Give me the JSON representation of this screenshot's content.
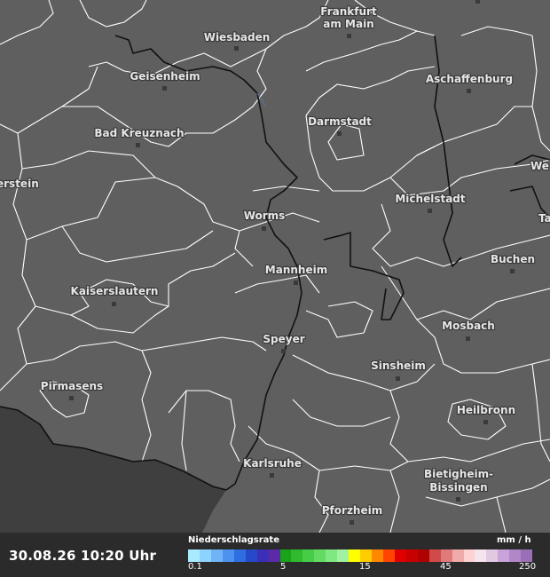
{
  "map": {
    "cities": [
      {
        "name": "Frankfurt\nam Main",
        "line1": "Frankfurt",
        "line2": "am Main"
      },
      {
        "name": "Wiesbaden"
      },
      {
        "name": "Geisenheim"
      },
      {
        "name": "Aschaffenburg"
      },
      {
        "name": "Bad Kreuznach"
      },
      {
        "name": "Darmstadt"
      },
      {
        "name": "Michelstadt"
      },
      {
        "name": "Worms"
      },
      {
        "name": "Buchen"
      },
      {
        "name": "Mannheim"
      },
      {
        "name": "Kaiserslautern"
      },
      {
        "name": "Speyer"
      },
      {
        "name": "Mosbach"
      },
      {
        "name": "Sinsheim"
      },
      {
        "name": "Pirmasens"
      },
      {
        "name": "Heilbronn"
      },
      {
        "name": "Karlsruhe"
      },
      {
        "name": "Bietigheim-\nBissingen",
        "line1": "Bietigheim-",
        "line2": "Bissingen"
      },
      {
        "name": "Pforzheim"
      },
      {
        "name": "erstein"
      },
      {
        "name": "We"
      },
      {
        "name": "Ta"
      }
    ],
    "colors": {
      "land": "#5f5f5f",
      "foreign": "#3f3f3f",
      "admin_border": "#ffffff",
      "state_border": "#111111"
    }
  },
  "footer": {
    "timestamp": "30.08.26 10:20 Uhr",
    "legend_title": "Niederschlagsrate",
    "legend_unit": "mm / h",
    "ticks": [
      "0.1",
      "5",
      "15",
      "45",
      "250"
    ],
    "scale_colors": [
      "#a8eaff",
      "#8cd3ff",
      "#6fb4f5",
      "#4d92ee",
      "#2f6ee0",
      "#2549c8",
      "#3a2fb8",
      "#5a2aa8",
      "#19a319",
      "#2fba2f",
      "#47cc47",
      "#63db63",
      "#80e880",
      "#a0f2a0",
      "#ffff00",
      "#ffcc00",
      "#ff8800",
      "#ff4400",
      "#e00000",
      "#c80000",
      "#b00000",
      "#d04a4a",
      "#e07a7a",
      "#f0aaaa",
      "#ffd2d2",
      "#f5e4ee",
      "#e2c9e2",
      "#c9a3d9",
      "#b287c8",
      "#9b6fb8"
    ]
  }
}
